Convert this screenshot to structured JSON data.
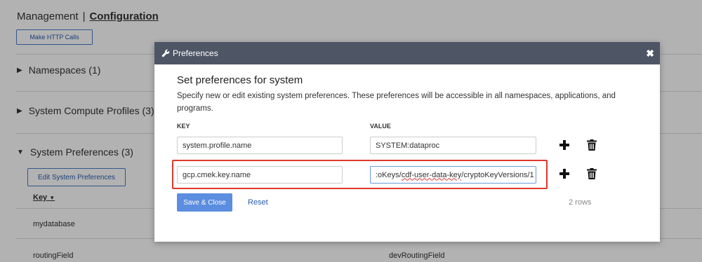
{
  "background": {
    "breadcrumb": {
      "parent": "Management",
      "separator": "|",
      "current": "Configuration"
    },
    "make_http_calls_label": "Make HTTP Calls",
    "sections": [
      {
        "label": "Namespaces (1)",
        "expanded": false
      },
      {
        "label": "System Compute Profiles (3)",
        "expanded": false
      },
      {
        "label": "System Preferences (3)",
        "expanded": true
      }
    ],
    "edit_system_preferences_label": "Edit System Preferences",
    "table": {
      "key_header": "Key",
      "rows": [
        {
          "key": "mydatabase",
          "value": ""
        },
        {
          "key": "routingField",
          "value": "devRoutingField"
        }
      ]
    }
  },
  "modal": {
    "header_title": "Preferences",
    "title": "Set preferences for system",
    "description": "Specify new or edit existing system preferences. These preferences will be accessible in all namespaces, applications, and programs.",
    "key_label": "KEY",
    "value_label": "VALUE",
    "rows": [
      {
        "key": "system.profile.name",
        "value": "SYSTEM:dataproc"
      },
      {
        "key": "gcp.cmek.key.name",
        "value_prefix": ":oKeys/",
        "value_squiggle": "cdf-user-data-key",
        "value_suffix": "/cryptoKeyVersions/1"
      }
    ],
    "save_close_label": "Save & Close",
    "reset_label": "Reset",
    "rows_count": "2 rows"
  },
  "colors": {
    "modal_header": "#4e5666",
    "primary_button": "#5b8de0",
    "highlight_border": "#e0392b",
    "link": "#2a5db0"
  }
}
